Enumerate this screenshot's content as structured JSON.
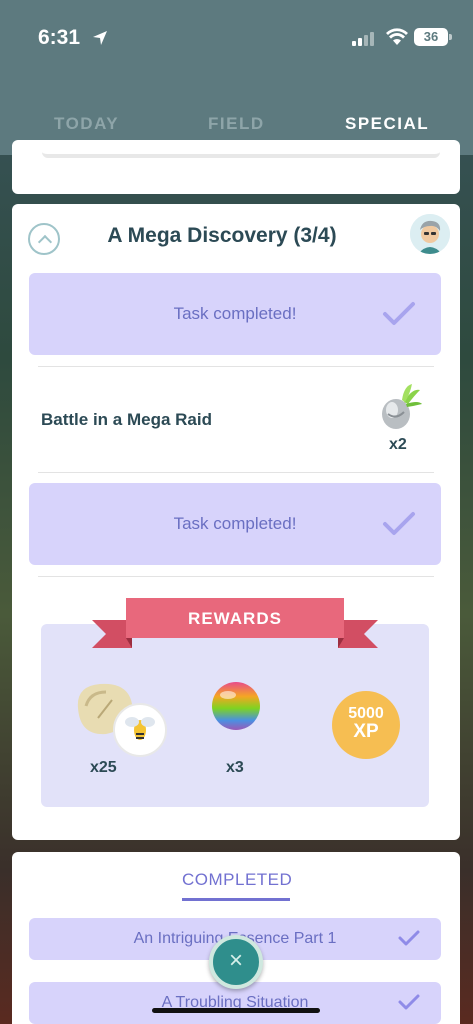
{
  "status_bar": {
    "time": "6:31",
    "battery": "36"
  },
  "tabs": [
    {
      "label": "TODAY"
    },
    {
      "label": "FIELD"
    },
    {
      "label": "SPECIAL",
      "active": true
    }
  ],
  "quest": {
    "title": "A Mega Discovery (3/4)",
    "tasks": [
      {
        "state": "completed",
        "label": "Task completed!"
      },
      {
        "state": "active",
        "label": "Battle in a Mega Raid",
        "reward_icon": "silver-pinap-berry-icon",
        "reward_qty": "x2"
      },
      {
        "state": "completed",
        "label": "Task completed!"
      }
    ],
    "rewards": {
      "header": "REWARDS",
      "items": [
        {
          "icon": "mega-energy-beedrill-icon",
          "qty": "x25"
        },
        {
          "icon": "rare-candy-icon",
          "qty": "x3"
        },
        {
          "icon": "xp-icon",
          "xp_value": "5000",
          "xp_unit": "XP"
        }
      ]
    }
  },
  "completed_section": {
    "tab_label": "COMPLETED",
    "items": [
      {
        "label": "An Intriguing Essence Part 1"
      },
      {
        "label": "A Troubling Situation"
      }
    ]
  },
  "colors": {
    "header_bg": "#5d7a7f",
    "task_done_bg": "#d7d3fb",
    "task_done_text": "#6a6fc2",
    "ribbon": "#e8687c",
    "xp_badge": "#f6be52",
    "title_text": "#2c4a55"
  }
}
